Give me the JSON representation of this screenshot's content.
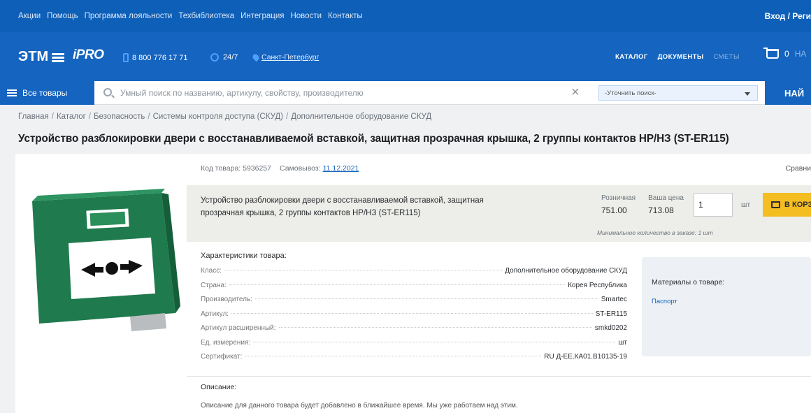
{
  "topbar": {
    "nav": [
      "Акции",
      "Помощь",
      "Программа лояльности",
      "Техбиблиотека",
      "Интеграция",
      "Новости",
      "Контакты"
    ],
    "login": "Вход / Реги"
  },
  "header": {
    "logo": "ЭТМ",
    "ipro": "iPRO",
    "phone": "8 800 776 17 71",
    "hours": "24/7",
    "city": "Санкт-Петербург",
    "nav": [
      "КАТАЛОГ",
      "ДОКУМЕНТЫ",
      "СМЕТЫ"
    ],
    "cart_count": "0",
    "cart_rest": "НА"
  },
  "search": {
    "all_goods": "Все товары",
    "placeholder": "Умный поиск по названию, артикулу, свойству, производителю",
    "refine": "-Уточнить поиск-",
    "find": "НАЙ"
  },
  "breadcrumbs": [
    "Главная",
    "Каталог",
    "Безопасность",
    "Системы контроля доступа (СКУД)",
    "Дополнительное оборудование СКУД"
  ],
  "product": {
    "title": "Устройство разблокировки двери с восстанавливаемой вставкой, защитная прозрачная крышка, 2 группы контактов НР/НЗ (ST-ER115)",
    "code_label": "Код товара: 5936257",
    "pickup_label": "Самовывоз:",
    "pickup_date": "11.12.2021",
    "compare": "Сравни",
    "name": "Устройство разблокировки двери с восстанавливаемой вставкой, защитная прозрачная крышка, 2 группы контактов НР/НЗ (ST-ER115)",
    "retail_label": "Розничная",
    "retail_price": "751.00",
    "your_label": "Ваша цена",
    "your_price": "713.08",
    "qty": "1",
    "unit": "шт",
    "to_cart": "В КОРЗ",
    "min_qty": "Минимальное количество в заказе: 1 шт"
  },
  "characteristics": {
    "title": "Характеристики товара:",
    "rows": [
      {
        "k": "Класс:",
        "v": "Дополнительное оборудование СКУД"
      },
      {
        "k": "Страна:",
        "v": "Корея Республика"
      },
      {
        "k": "Производитель:",
        "v": "Smartec"
      },
      {
        "k": "Артикул:",
        "v": "ST-ER115"
      },
      {
        "k": "Артикул расширенный:",
        "v": "smkd0202"
      },
      {
        "k": "Ед. измерения:",
        "v": "шт"
      },
      {
        "k": "Сертификат:",
        "v": "RU Д-ЕЕ.КА01.В10135-19"
      }
    ]
  },
  "materials": {
    "title": "Материалы о товаре:",
    "link": "Паспорт"
  },
  "description": {
    "title": "Описание:",
    "text": "Описание для данного товара будет добавлено в ближайшее время. Мы уже работаем над этим."
  }
}
